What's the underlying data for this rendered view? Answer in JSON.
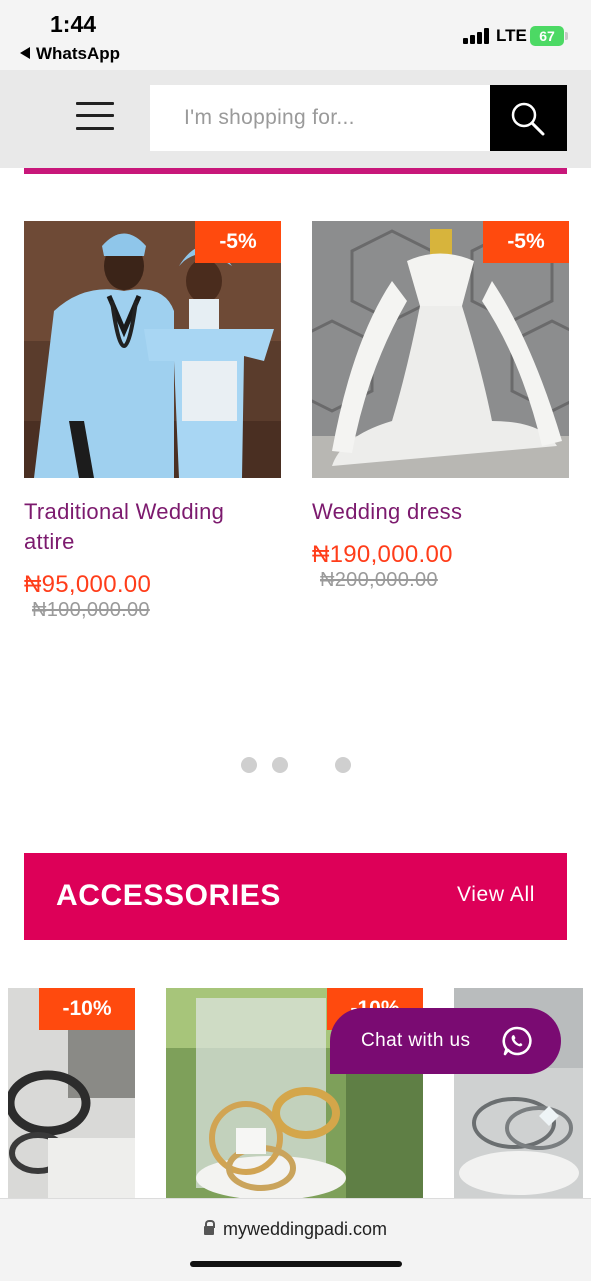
{
  "status_bar": {
    "time": "1:44",
    "back_app": "WhatsApp",
    "network": "LTE",
    "battery": "67"
  },
  "header": {
    "search_placeholder": "I'm shopping for..."
  },
  "products": [
    {
      "badge": "-5%",
      "name": "Traditional Wedding attire",
      "price": "₦95,000.00",
      "old_price": "₦100,000.00"
    },
    {
      "badge": "-5%",
      "name": "Wedding dress",
      "price": "₦190,000.00",
      "old_price": "₦200,000.00"
    }
  ],
  "accessories": {
    "title": "ACCESSORIES",
    "view_all": "View All",
    "badges": [
      "-10%",
      "-10%"
    ]
  },
  "chat": {
    "label": "Chat with us"
  },
  "browser": {
    "url": "myweddingpadi.com"
  },
  "colors": {
    "accent_pink": "#dd0058",
    "badge_orange": "#ff4a0e",
    "product_name": "#7c1a6e",
    "price": "#ff3d1a",
    "chat_purple": "#7a0b72"
  }
}
